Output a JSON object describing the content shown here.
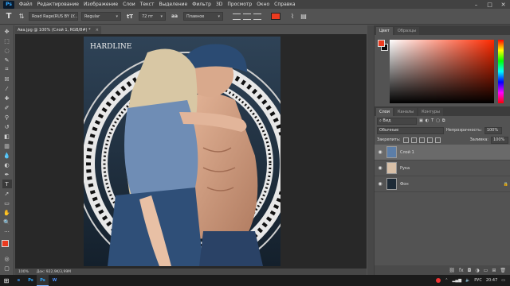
{
  "menubar": {
    "logo": "Ps",
    "items": [
      "Файл",
      "Редактирование",
      "Изображение",
      "Слои",
      "Текст",
      "Выделение",
      "Фильтр",
      "3D",
      "Просмотр",
      "Окно",
      "Справка"
    ],
    "window_controls": [
      "–",
      "□",
      "✕"
    ]
  },
  "options": {
    "tool_glyph": "T",
    "font_family": "Road Rage(RUS BY LY...",
    "font_style": "Regular",
    "font_size": "72 пт",
    "antialias": "Плавное",
    "text_color": "#ec3b1f"
  },
  "document": {
    "tab_title": "Ава.jpg @ 100% (Слой 1, RGB/8#) *",
    "close": "×",
    "artwork_text": "HARDLINE",
    "status_zoom": "100%",
    "status_info": "Док: 922,9K/3,99M"
  },
  "colors": {
    "foreground": "#ec3b1f",
    "background": "#0d0d0d"
  },
  "color_panel": {
    "tabs": [
      "Цвет",
      "Образцы"
    ]
  },
  "layers_panel": {
    "tabs": [
      "Слои",
      "Каналы",
      "Контуры"
    ],
    "filter_label": "Вид",
    "blend_mode": "Обычные",
    "opacity_label": "Непрозрачность:",
    "opacity_value": "100%",
    "lock_label": "Закрепить:",
    "fill_label": "Заливка:",
    "fill_value": "100%",
    "layers": [
      {
        "name": "Слой 1",
        "selected": true
      },
      {
        "name": "Рука",
        "selected": false
      },
      {
        "name": "Фон",
        "selected": false
      }
    ]
  },
  "taskbar": {
    "apps": [
      "e",
      "Ps",
      "Ps",
      "W"
    ],
    "lang": "РУС",
    "time": "20:47"
  }
}
